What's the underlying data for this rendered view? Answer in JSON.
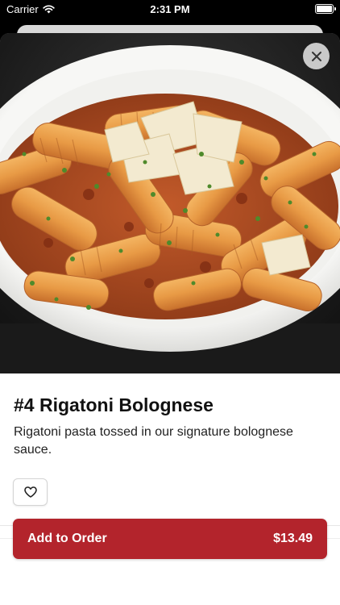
{
  "status_bar": {
    "carrier": "Carrier",
    "time": "2:31 PM"
  },
  "item": {
    "title": "#4 Rigatoni Bolognese",
    "description": "Rigatoni pasta tossed in our signature bolognese sauce."
  },
  "order_button": {
    "label": "Add to Order",
    "price": "$13.49"
  },
  "colors": {
    "accent": "#b3242c"
  },
  "icons": {
    "close": "close-icon",
    "favorite": "heart-icon",
    "wifi": "wifi-icon",
    "battery": "battery-icon"
  }
}
